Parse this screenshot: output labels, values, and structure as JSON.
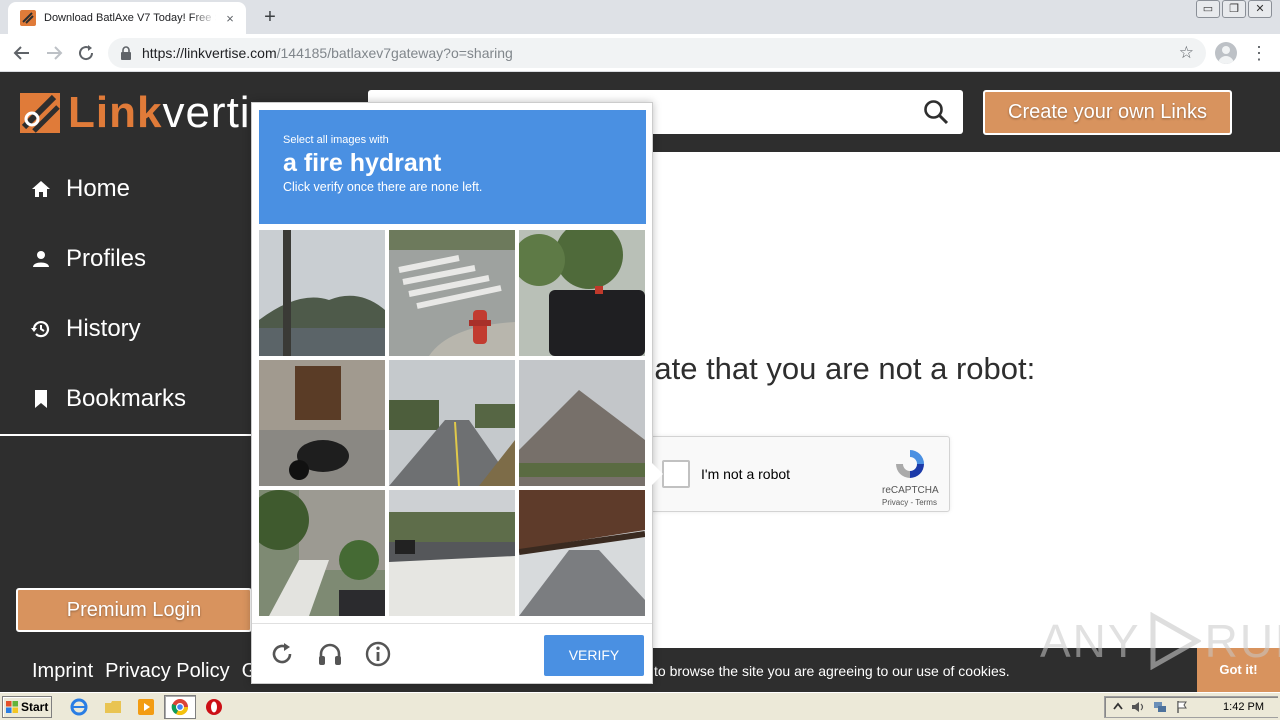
{
  "browser": {
    "tab_title": "Download BatlAxe V7 Today! Free S",
    "tab_close_icon": "×",
    "new_tab_icon": "+",
    "url_host": "https://linkvertise.com",
    "url_path": "/144185/batlaxev7gateway?o=sharing",
    "window_buttons": [
      "▭",
      "❐",
      "✕"
    ]
  },
  "site": {
    "logo_link": "Link",
    "logo_vertise": "verti",
    "create_button": "Create your own Links",
    "sidebar": {
      "items": [
        {
          "label": "Home",
          "icon": "home-icon"
        },
        {
          "label": "Profiles",
          "icon": "person-icon"
        },
        {
          "label": "History",
          "icon": "history-icon"
        },
        {
          "label": "Bookmarks",
          "icon": "bookmark-icon"
        }
      ],
      "premium_button": "Premium Login"
    },
    "validate_text": "e validate that you are not a robot:",
    "recaptcha": {
      "checkbox_label": "I'm not a robot",
      "brand": "reCAPTCHA",
      "terms": "Privacy - Terms"
    },
    "footer": {
      "links": [
        "Imprint",
        "Privacy Policy",
        "G"
      ],
      "cookie_text": "to browse the site you are agreeing to our use of cookies.",
      "got_it": "Got it!"
    }
  },
  "challenge": {
    "line1": "Select all images with",
    "target": "a fire hydrant",
    "line3": "Click verify once there are none left.",
    "verify_button": "VERIFY",
    "tiles": [
      "pole-hill",
      "crosswalk-hydrant",
      "car-tree",
      "door-scooter",
      "road-trees",
      "roof",
      "stairs-house",
      "road-wall",
      "bridge-road"
    ]
  },
  "watermark": {
    "left": "ANY",
    "right": "RUN"
  },
  "taskbar": {
    "start_label": "Start",
    "clock": "1:42 PM"
  },
  "colors": {
    "accent_orange": "#d8935e",
    "logo_orange": "#e07b39",
    "dark": "#2e2e2e",
    "captcha_blue": "#4a90e2"
  }
}
